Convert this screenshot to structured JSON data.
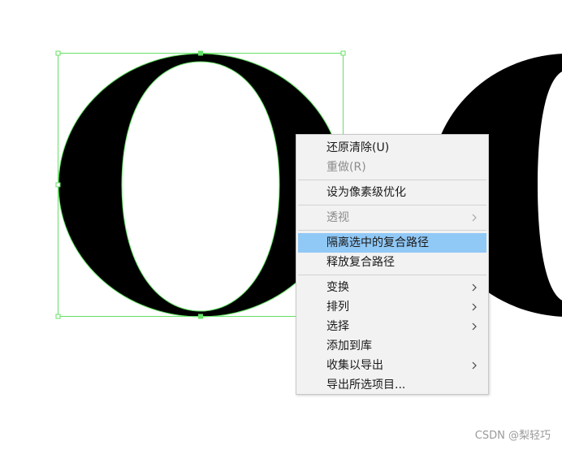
{
  "menu": {
    "items": [
      {
        "label": "还原清除(U)",
        "disabled": false,
        "submenu": false
      },
      {
        "label": "重做(R)",
        "disabled": true,
        "submenu": false
      },
      {
        "label": "设为像素级优化",
        "disabled": false,
        "submenu": false
      },
      {
        "label": "透视",
        "disabled": true,
        "submenu": true
      },
      {
        "label": "隔离选中的复合路径",
        "disabled": false,
        "submenu": false,
        "highlighted": true
      },
      {
        "label": "释放复合路径",
        "disabled": false,
        "submenu": false
      },
      {
        "label": "变换",
        "disabled": false,
        "submenu": true
      },
      {
        "label": "排列",
        "disabled": false,
        "submenu": true
      },
      {
        "label": "选择",
        "disabled": false,
        "submenu": true
      },
      {
        "label": "添加到库",
        "disabled": false,
        "submenu": false
      },
      {
        "label": "收集以导出",
        "disabled": false,
        "submenu": true
      },
      {
        "label": "导出所选项目...",
        "disabled": false,
        "submenu": false
      }
    ],
    "highlight_color": "#90c8f6"
  },
  "canvas": {
    "selection_color": "#66e066",
    "glyph_color": "#000000"
  },
  "watermark": {
    "text": "CSDN @梨轻巧"
  }
}
